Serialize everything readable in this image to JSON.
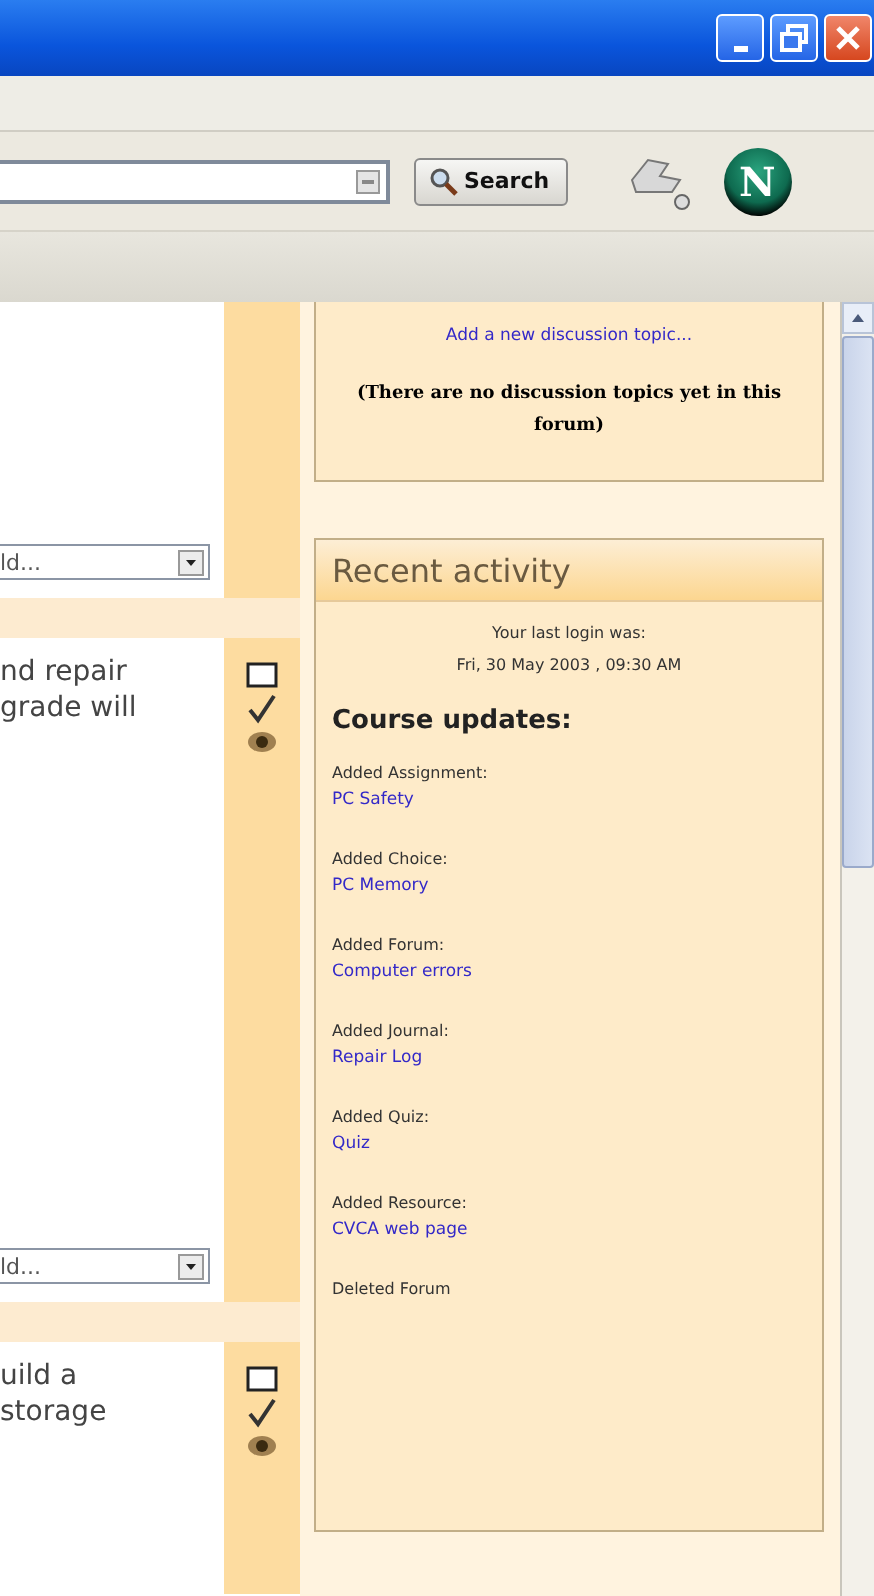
{
  "window": {
    "controls": [
      {
        "kind": "minimize"
      },
      {
        "kind": "restore"
      },
      {
        "kind": "close"
      }
    ]
  },
  "toolbar": {
    "search_button": "Search",
    "logo_letter": "N"
  },
  "course": {
    "sections": [
      {
        "dropdown": "ld...",
        "edit_icons": false
      },
      {
        "lines": [
          "nd repair",
          "grade will"
        ],
        "dropdown": "ld...",
        "edit_icons": true
      },
      {
        "lines": [
          "uild a",
          "storage"
        ],
        "edit_icons": true
      }
    ]
  },
  "sidebar": {
    "forum_block": {
      "link": "Add a new discussion topic...",
      "message": "(There are no discussion topics yet in this forum)"
    },
    "recent_activity": {
      "title": "Recent activity",
      "login_label": "Your last login was:",
      "login_time": "Fri, 30 May 2003 , 09:30 AM",
      "heading": "Course updates:",
      "updates": [
        {
          "label": "Added Assignment:",
          "link": "PC Safety"
        },
        {
          "label": "Added Choice:",
          "link": "PC Memory"
        },
        {
          "label": "Added Forum:",
          "link": "Computer errors"
        },
        {
          "label": "Added Journal:",
          "link": "Repair Log"
        },
        {
          "label": "Added Quiz:",
          "link": "Quiz"
        },
        {
          "label": "Added Resource:",
          "link": "CVCA web page"
        },
        {
          "label": "Deleted Forum"
        }
      ]
    }
  }
}
